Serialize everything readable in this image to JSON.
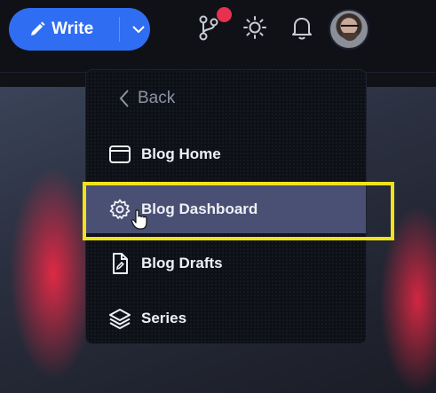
{
  "header": {
    "write_label": "Write",
    "icons": [
      "pencil-icon",
      "chevron-down-icon",
      "git-branch-icon",
      "sun-icon",
      "bell-icon"
    ],
    "notification_badge_color": "#e8304f"
  },
  "menu": {
    "back_label": "Back",
    "items": [
      {
        "label": "Blog Home",
        "icon": "window-icon"
      },
      {
        "label": "Blog Dashboard",
        "icon": "gear-icon",
        "active": true
      },
      {
        "label": "Blog Drafts",
        "icon": "file-pen-icon"
      },
      {
        "label": "Series",
        "icon": "layers-icon"
      }
    ]
  },
  "colors": {
    "accent": "#2f6ef2",
    "active_item": "#4a4f74",
    "highlight_box": "#f1e21e"
  }
}
